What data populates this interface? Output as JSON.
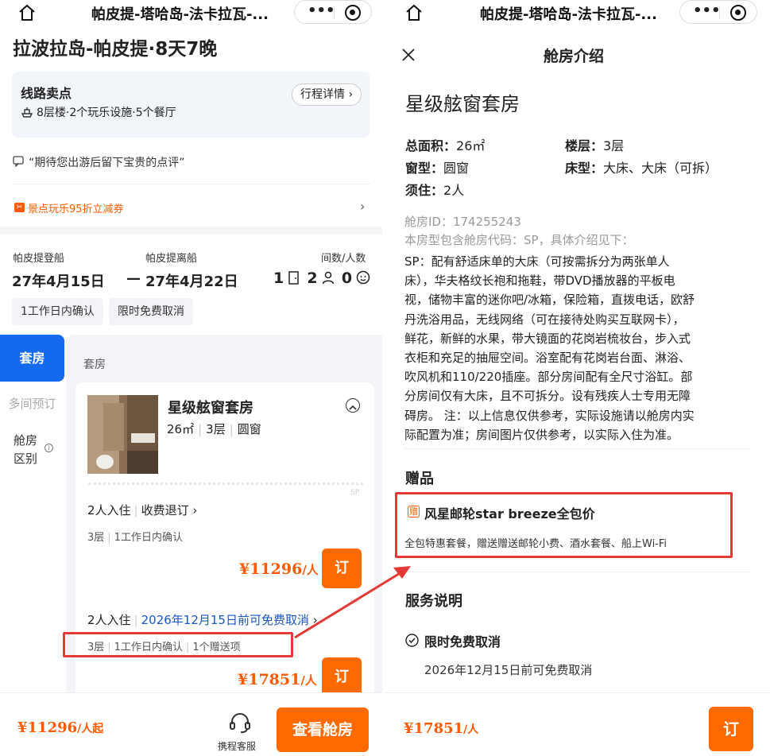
{
  "left": {
    "nav_title": "帕皮提-塔哈岛-法卡拉瓦-...",
    "trip_title": "拉波拉岛-帕皮提·8天7晚",
    "highlights": {
      "title": "线路卖点",
      "detail_button": "行程详情",
      "facilities": "8层楼·2个玩乐设施·5个餐厅"
    },
    "review_prompt": "“期待您出游后留下宝贵的点评”",
    "coupon_text": "景点玩乐95折立减券",
    "embark_label": "帕皮提登船",
    "disembark_label": "帕皮提离船",
    "rooms_people_label": "间数/人数",
    "embark_date": "27年4月15日",
    "disembark_date": "27年4月22日",
    "date_dash": "—",
    "rooms_count": "1",
    "adults_count": "2",
    "children_count": "0",
    "tags": [
      "1工作日内确认",
      "限时免费取消"
    ],
    "side_tabs": {
      "suite": "套房",
      "multi_room": "多间预订",
      "diff_line1": "舱房",
      "diff_line2": "区别"
    },
    "section_label": "套房",
    "cabin": {
      "name": "星级舷窗套房",
      "area": "26㎡",
      "floor": "3层",
      "window": "圆窗",
      "sp_label": "SP"
    },
    "offers": [
      {
        "occupancy": "2人入住",
        "policy": "收费退订",
        "meta1": "3层",
        "meta2": "1工作日内确认",
        "meta3": "",
        "price": "¥11296",
        "price_unit": "/人",
        "book": "订"
      },
      {
        "occupancy": "2人入住",
        "policy": "2026年12月15日前可免费取消",
        "meta1": "3层",
        "meta2": "1工作日内确认",
        "meta3": "1个赠送项",
        "price": "¥17851",
        "price_unit": "/人",
        "book": "订"
      }
    ],
    "bottom": {
      "price": "¥11296",
      "price_unit": "/人起",
      "service_label": "携程客服",
      "view_button": "查看舱房"
    }
  },
  "right": {
    "nav_title": "帕皮提-塔哈岛-法卡拉瓦-...",
    "sheet_title": "舱房介绍",
    "room_name": "星级舷窗套房",
    "specs": {
      "area_label": "总面积：",
      "area_value": "26㎡",
      "floor_label": "楼层：",
      "floor_value": "3层",
      "window_label": "窗型：",
      "window_value": "圆窗",
      "bed_label": "床型：",
      "bed_value": "大床、大床（可拆）",
      "occupancy_label": "须住：",
      "occupancy_value": "2人"
    },
    "cabin_id": "舱房ID：174255243",
    "cabin_code_note": "本房型包含舱房代码：SP，具体介绍见下：",
    "description_lines": [
      "SP：配有舒适床单的大床（可按需拆分为两张单人",
      "床），华夫格纹长袍和拖鞋，带DVD播放器的平板电",
      "视，储物丰富的迷你吧/冰箱，保险箱，直拨电话，欧舒",
      "丹洗浴用品，无线网络（可在接待处购买互联网卡），",
      "鲜花，新鲜的水果，带大镜面的花岗岩梳妆台，步入式",
      "衣柜和充足的抽屉空间。浴室配有花岗岩台面、淋浴、",
      "吹风机和110/220插座。部分房间配有全尺寸浴缸。部",
      "分房间仅有大床，且不可拆分。设有残疾人士专用无障",
      "碍房。 注：以上信息仅供参考，实际设施请以舱房内实",
      "际配置为准；房间图片仅供参考，以实际入住为准。"
    ],
    "gift_heading": "赠品",
    "gift_badge": "赠",
    "gift_title": "风星邮轮star breeze全包价",
    "gift_desc": "全包特惠套餐，赠送赠送邮轮小费、酒水套餐、船上Wi-Fi",
    "service_heading": "服务说明",
    "cancel_title": "限时免费取消",
    "cancel_desc": "2026年12月15日前可免费取消",
    "bottom_price": "¥17851",
    "bottom_unit": "/人",
    "book_button": "订"
  },
  "colors": {
    "accent": "#ff6a00",
    "price": "#ff5a00",
    "blue": "#0066ff",
    "link": "#1a56c4",
    "highlight_box": "#e53935"
  },
  "icons": [
    "home-icon",
    "more-icon",
    "target-icon",
    "close-icon",
    "ship-icon",
    "comment-icon",
    "coupon-icon",
    "chevron-right-icon",
    "door-icon",
    "person-icon",
    "baby-icon",
    "info-icon",
    "chevron-up-icon",
    "headset-icon",
    "check-circle-icon",
    "arrow-icon"
  ]
}
